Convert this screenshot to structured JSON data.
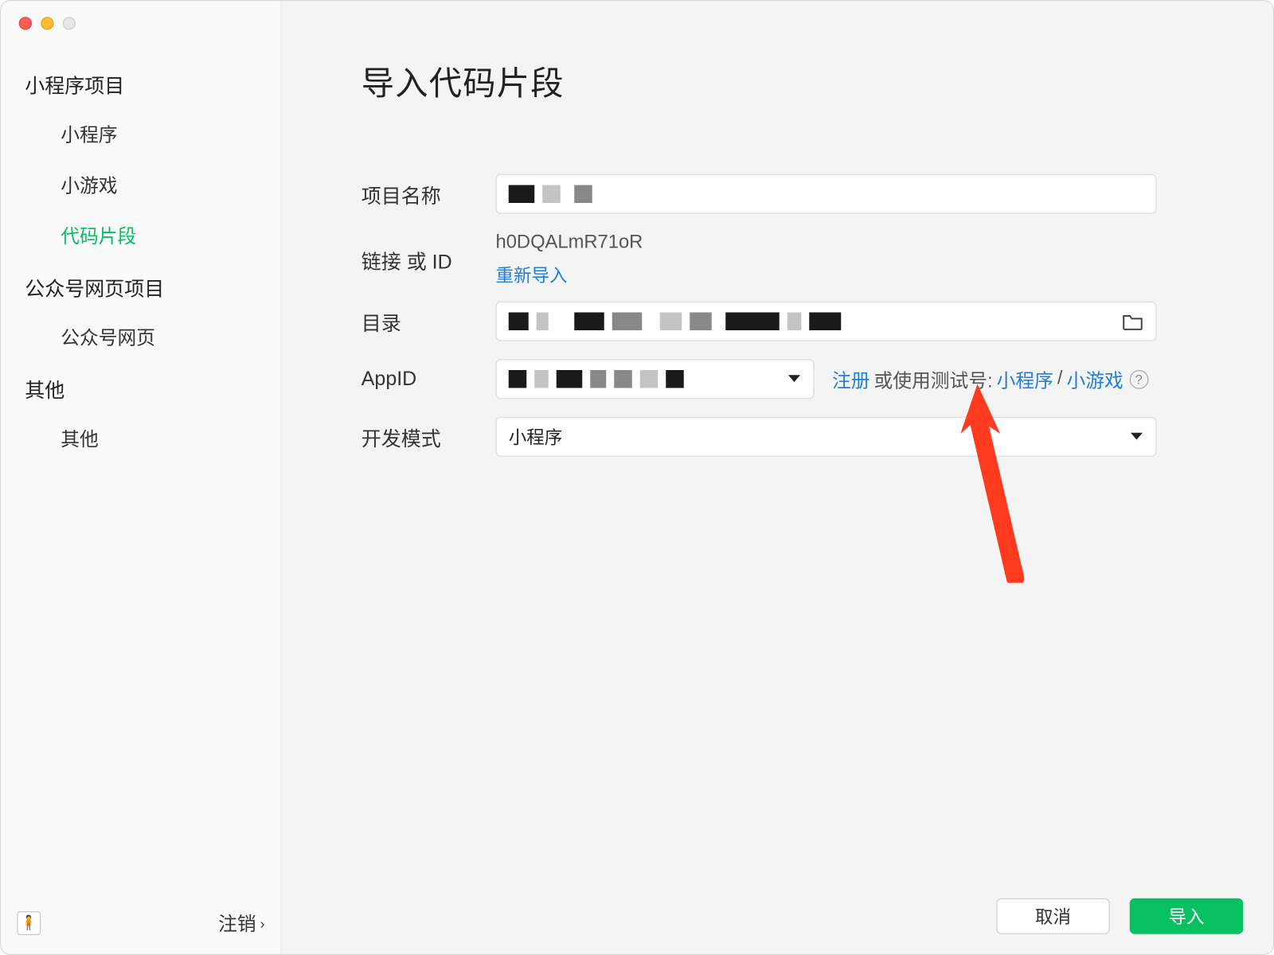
{
  "sidebar": {
    "groups": [
      {
        "title": "小程序项目",
        "items": [
          "小程序",
          "小游戏",
          "代码片段"
        ],
        "activeIndex": 2
      },
      {
        "title": "公众号网页项目",
        "items": [
          "公众号网页"
        ]
      },
      {
        "title": "其他",
        "items": [
          "其他"
        ]
      }
    ],
    "logout_label": "注销"
  },
  "page": {
    "title": "导入代码片段"
  },
  "form": {
    "project_name_label": "项目名称",
    "link_id_label": "链接 或 ID",
    "link_id_value": "h0DQALmR71oR",
    "reimport_label": "重新导入",
    "directory_label": "目录",
    "appid_label": "AppID",
    "dev_mode_label": "开发模式",
    "dev_mode_value": "小程序",
    "register_text": "注册",
    "or_use_test_text": " 或使用测试号: ",
    "test_mini_link": "小程序",
    "separator": " / ",
    "test_game_link": "小游戏"
  },
  "footer": {
    "cancel": "取消",
    "import": "导入"
  }
}
